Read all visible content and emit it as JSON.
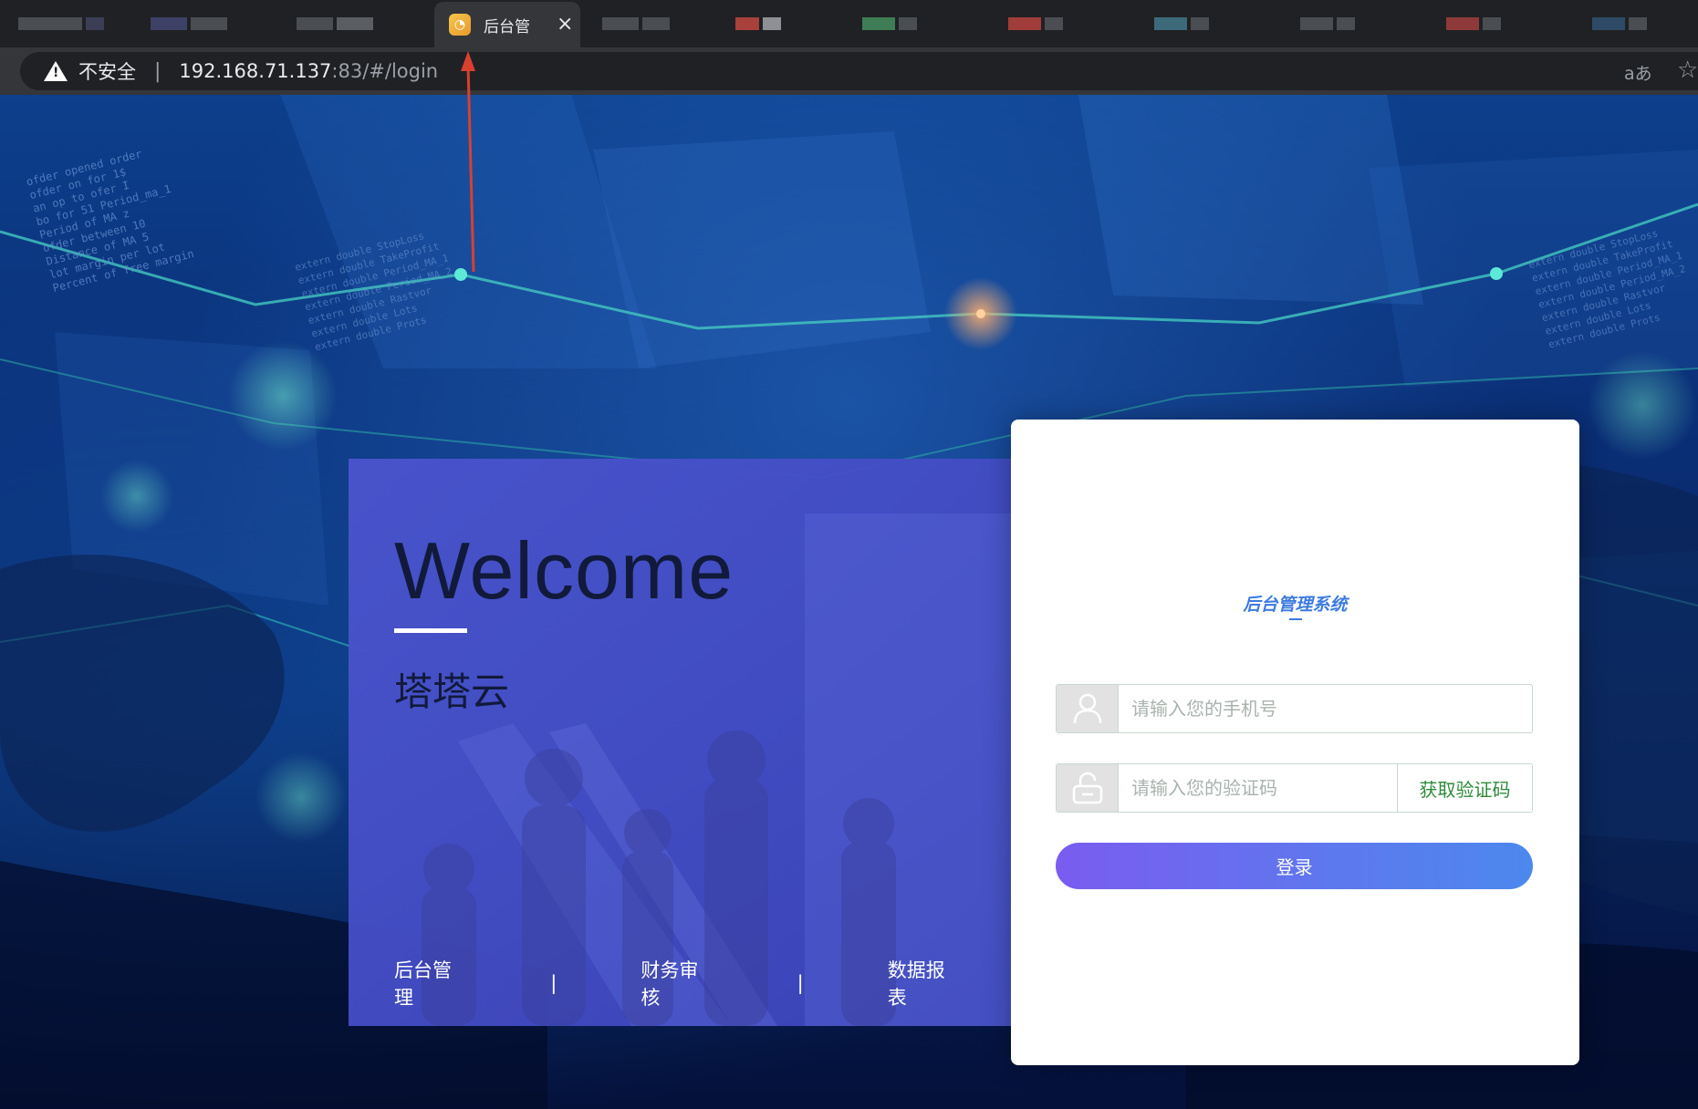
{
  "browser": {
    "active_tab": {
      "title": "后台管",
      "close_glyph": "×"
    },
    "address_bar": {
      "security_label": "不安全",
      "url_host": "192.168.71.137",
      "url_rest": ":83/#/login"
    },
    "icons": {
      "warning": "warning-icon",
      "translate": "translate-icon",
      "bookmark": "star-icon"
    }
  },
  "background_text": {
    "code_left": [
      "ofder opened order",
      "ofder on for 1$",
      "an op to ofer I",
      "bo for 51 Period_ma_1",
      "Period of MA z",
      "ofder between 10",
      "Distance of MA 5",
      "lot margin per lot",
      "Percent of free margin"
    ],
    "code_mid": [
      "extern double StopLoss",
      "extern double TakeProfit",
      "extern double Period_MA_1",
      "extern double Period_MA_2",
      "extern double Rastvor",
      "extern double Lots",
      "extern double Prots"
    ],
    "code_right": [
      "extern double StopLoss",
      "extern double TakeProfit",
      "extern double Period_MA_1",
      "extern double Period_MA_2",
      "extern double Rastvor",
      "extern double Lots",
      "extern double Prots"
    ]
  },
  "welcome_panel": {
    "heading": "Welcome",
    "brand": "塔塔云",
    "links": [
      "后台管理",
      "财务审核",
      "数据报表"
    ],
    "separator": "|"
  },
  "login": {
    "system_title": "后台管理系统",
    "phone_placeholder": "请输入您的手机号",
    "code_placeholder": "请输入您的验证码",
    "get_code_label": "获取验证码",
    "submit_label": "登录",
    "accent_color": "#3d7be0",
    "get_code_color": "#2e8b3a"
  }
}
